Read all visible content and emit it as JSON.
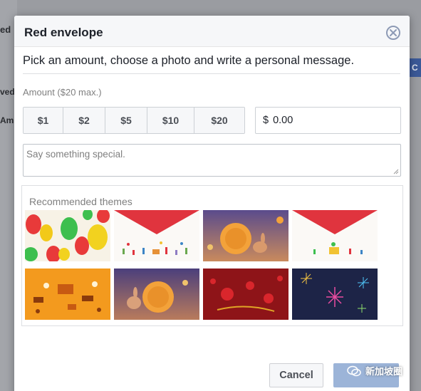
{
  "background": {
    "frag_1": "ed",
    "frag_2": "ved",
    "frag_3": "Am",
    "right_button_label": "C"
  },
  "dialog": {
    "title": "Red envelope",
    "close_icon": "close-circle-icon",
    "instructions": "Pick an amount, choose a photo and write a personal message.",
    "amount_label": "Amount ($20 max.)",
    "amount_options": [
      "$1",
      "$2",
      "$5",
      "$10",
      "$20"
    ],
    "amount_currency": "$",
    "amount_value": "0.00",
    "message_placeholder": "Say something special.",
    "themes_title": "Recommended themes",
    "themes": [
      {
        "name": "balloons"
      },
      {
        "name": "red-envelope-party"
      },
      {
        "name": "mooncake-rabbit-dusk"
      },
      {
        "name": "red-envelope-celebration"
      },
      {
        "name": "orange-festival"
      },
      {
        "name": "mooncake-rabbit-night"
      },
      {
        "name": "red-lanterns-dragon"
      },
      {
        "name": "fireworks"
      }
    ],
    "cancel_label": "Cancel",
    "send_label": ""
  },
  "watermark": {
    "text": "新加坡圈"
  },
  "colors": {
    "header_bg": "#f6f7f9",
    "send_button": "#9cb4d8",
    "envelope_red": "#e0343e",
    "brand_blue": "#3b5998"
  }
}
